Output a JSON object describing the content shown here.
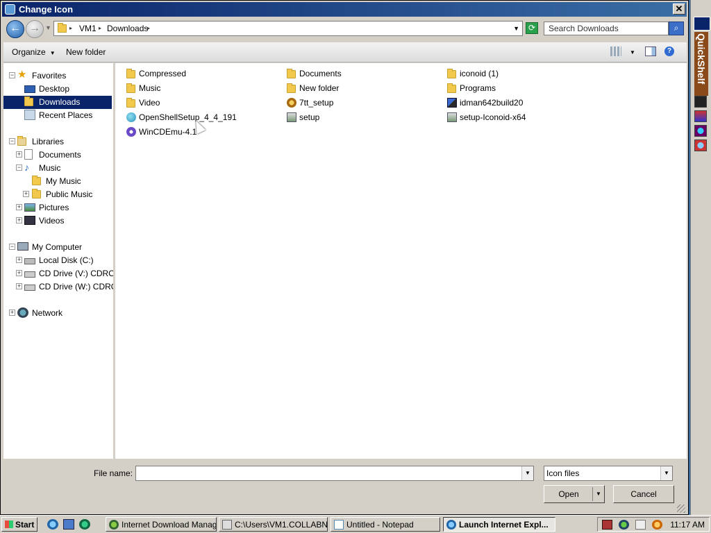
{
  "window": {
    "title": "Change Icon"
  },
  "nav": {
    "crumbs": [
      "VM1",
      "Downloads"
    ],
    "search_placeholder": "Search Downloads"
  },
  "toolbar": {
    "organize": "Organize",
    "new_folder": "New folder"
  },
  "tree": [
    {
      "label": "Favorites",
      "icon": "star-icon",
      "expander": "minus"
    },
    {
      "label": "Desktop",
      "icon": "desktop-icon"
    },
    {
      "label": "Downloads",
      "icon": "downloads-folder-icon",
      "selected": true
    },
    {
      "label": "Recent Places",
      "icon": "recent-places-icon"
    },
    {
      "label": "Libraries",
      "icon": "libraries-icon",
      "expander": "minus"
    },
    {
      "label": "Documents",
      "icon": "documents-icon",
      "expander": "plus"
    },
    {
      "label": "Music",
      "icon": "music-icon",
      "expander": "minus"
    },
    {
      "label": "My Music",
      "icon": "folder-icon"
    },
    {
      "label": "Public Music",
      "icon": "folder-icon",
      "expander": "plus"
    },
    {
      "label": "Pictures",
      "icon": "pictures-icon",
      "expander": "plus"
    },
    {
      "label": "Videos",
      "icon": "videos-icon",
      "expander": "plus"
    },
    {
      "label": "My Computer",
      "icon": "computer-icon",
      "expander": "minus"
    },
    {
      "label": "Local Disk (C:)",
      "icon": "hard-disk-icon",
      "expander": "plus"
    },
    {
      "label": "CD Drive (V:) CDROM",
      "icon": "cd-drive-icon",
      "expander": "plus"
    },
    {
      "label": "CD Drive (W:) CDROM",
      "icon": "cd-drive-icon",
      "expander": "plus"
    },
    {
      "label": "Network",
      "icon": "network-icon",
      "expander": "plus"
    }
  ],
  "files": [
    {
      "name": "Compressed",
      "icon": "folder-icon"
    },
    {
      "name": "Documents",
      "icon": "folder-icon"
    },
    {
      "name": "iconoid (1)",
      "icon": "folder-icon"
    },
    {
      "name": "Music",
      "icon": "folder-icon"
    },
    {
      "name": "New folder",
      "icon": "folder-icon"
    },
    {
      "name": "Programs",
      "icon": "folder-icon"
    },
    {
      "name": "Video",
      "icon": "folder-icon"
    },
    {
      "name": "7tt_setup",
      "icon": "installer-icon"
    },
    {
      "name": "idman642build20",
      "icon": "idm-icon"
    },
    {
      "name": "OpenShellSetup_4_4_191",
      "icon": "openshell-icon"
    },
    {
      "name": "setup",
      "icon": "setup-icon"
    },
    {
      "name": "setup-Iconoid-x64",
      "icon": "setup-icon"
    },
    {
      "name": "WinCDEmu-4.1",
      "icon": "wincdemu-icon"
    }
  ],
  "bottom": {
    "file_name_label": "File name:",
    "file_name_value": "",
    "file_type": "Icon files",
    "open": "Open",
    "cancel": "Cancel"
  },
  "quickshelf": {
    "title": "QuickShelf"
  },
  "taskbar": {
    "start": "Start",
    "tasks": [
      {
        "label": "Internet Download Manag...",
        "active": false
      },
      {
        "label": "C:\\Users\\VM1.COLLABN...",
        "active": false
      },
      {
        "label": "Untitled - Notepad",
        "active": false
      },
      {
        "label": "Launch Internet Expl...",
        "active": true
      }
    ],
    "clock": "11:17 AM"
  },
  "colors": {
    "selection": "#0a246a",
    "titlebar": "#0a246a",
    "folder": "#f2c94c"
  }
}
